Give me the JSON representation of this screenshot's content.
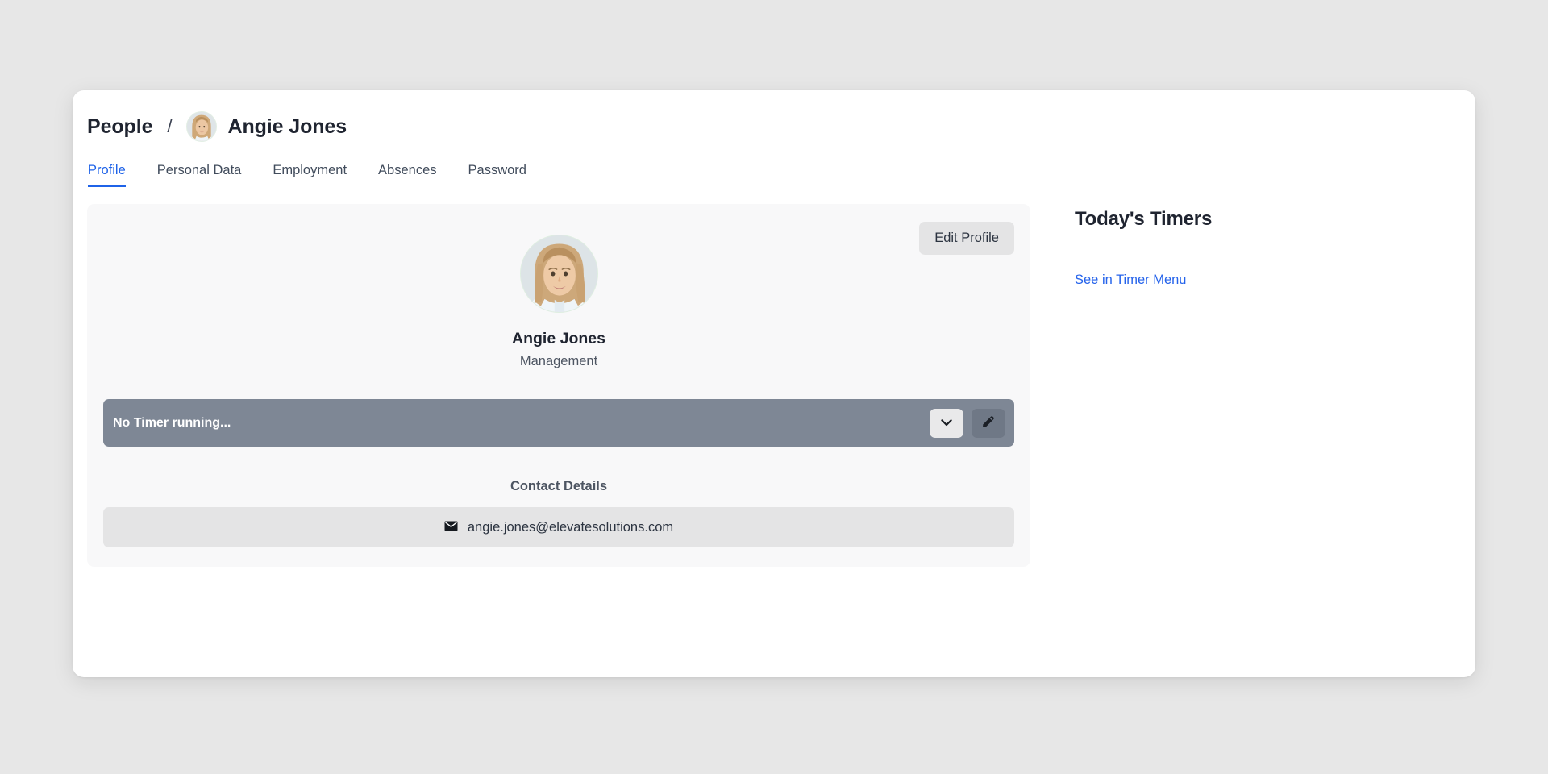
{
  "breadcrumb": {
    "root_label": "People",
    "separator": "/",
    "person_name": "Angie Jones",
    "avatar_icon": "user-avatar-photo"
  },
  "tabs": [
    {
      "label": "Profile",
      "active": true
    },
    {
      "label": "Personal Data",
      "active": false
    },
    {
      "label": "Employment",
      "active": false
    },
    {
      "label": "Absences",
      "active": false
    },
    {
      "label": "Password",
      "active": false
    }
  ],
  "profile_card": {
    "edit_button_label": "Edit Profile",
    "avatar_icon": "user-avatar-photo",
    "name": "Angie Jones",
    "role": "Management"
  },
  "timer": {
    "status_text": "No Timer running...",
    "expand_icon": "chevron-down-icon",
    "edit_icon": "pencil-icon"
  },
  "contact": {
    "heading": "Contact Details",
    "email_icon": "envelope-icon",
    "email": "angie.jones@elevatesolutions.com"
  },
  "sidebar": {
    "title": "Today's Timers",
    "link_label": "See in Timer Menu"
  },
  "colors": {
    "accent_blue": "#1f63e8",
    "link_blue": "#2563eb",
    "timer_bar": "#7e8795",
    "card_bg": "#f8f8f9",
    "row_bg": "#e4e4e5",
    "page_bg": "#e7e7e7",
    "text_dark": "#1f2430"
  }
}
